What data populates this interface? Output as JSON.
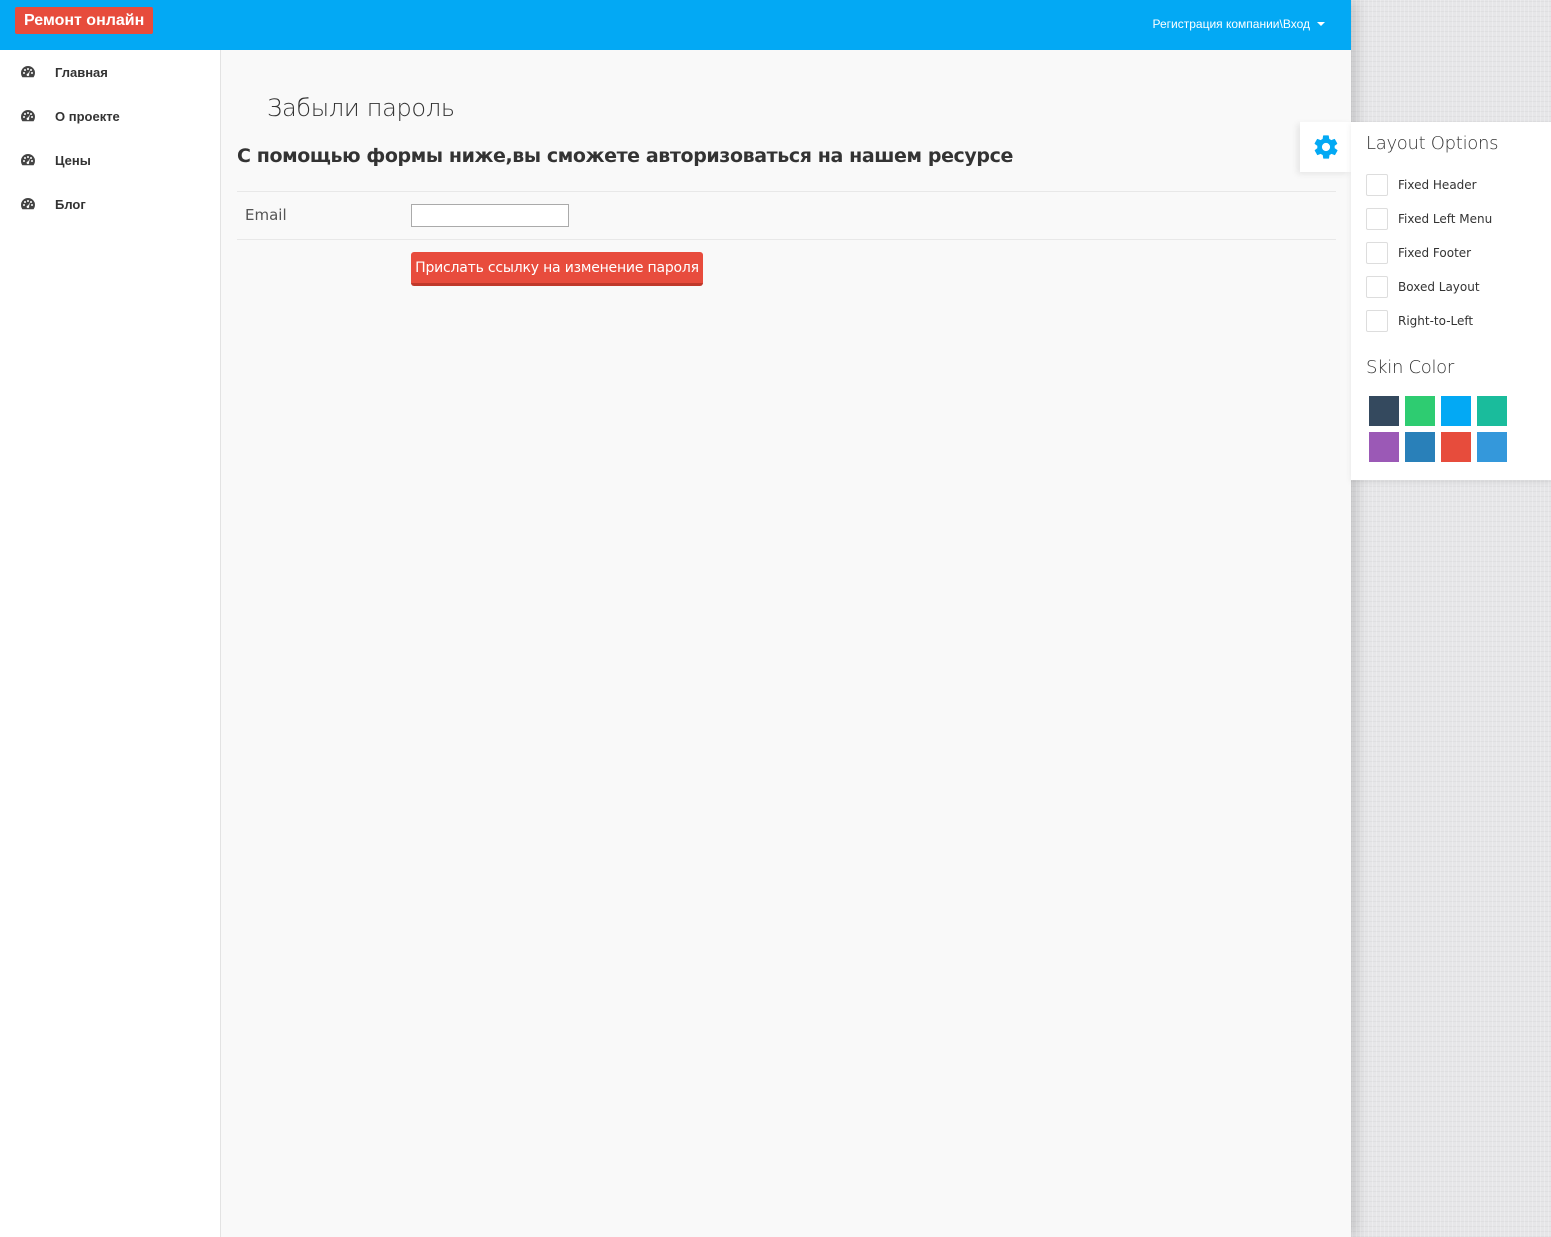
{
  "header": {
    "brand": "Ремонт онлайн",
    "user_menu": "Регистрация компании\\Вход"
  },
  "sidebar": {
    "items": [
      {
        "label": "Главная",
        "icon": "dashboard-icon"
      },
      {
        "label": "О проекте",
        "icon": "dashboard-icon"
      },
      {
        "label": "Цены",
        "icon": "dashboard-icon"
      },
      {
        "label": "Блог",
        "icon": "dashboard-icon"
      }
    ]
  },
  "main": {
    "title": "Забыли пароль",
    "subtitle": "С помощью формы ниже,вы сможете авторизоваться на нашем ресурсе",
    "email_label": "Email",
    "email_value": "",
    "submit_label": "Прислать ссылку на изменение пароля"
  },
  "layout_panel": {
    "title": "Layout Options",
    "options": [
      {
        "label": "Fixed Header",
        "checked": false
      },
      {
        "label": "Fixed Left Menu",
        "checked": false
      },
      {
        "label": "Fixed Footer",
        "checked": false
      },
      {
        "label": "Boxed Layout",
        "checked": false
      },
      {
        "label": "Right-to-Left",
        "checked": false
      }
    ],
    "skin_title": "Skin Color",
    "skins": [
      "#34495e",
      "#2ecc71",
      "#03a9f4",
      "#1abc9c",
      "#9b59b6",
      "#2980b9",
      "#e74c3c",
      "#3498db"
    ]
  },
  "colors": {
    "header": "#03a9f4",
    "brand": "#e74c3c",
    "button": "#e84c3d",
    "gear": "#03a9f4"
  }
}
